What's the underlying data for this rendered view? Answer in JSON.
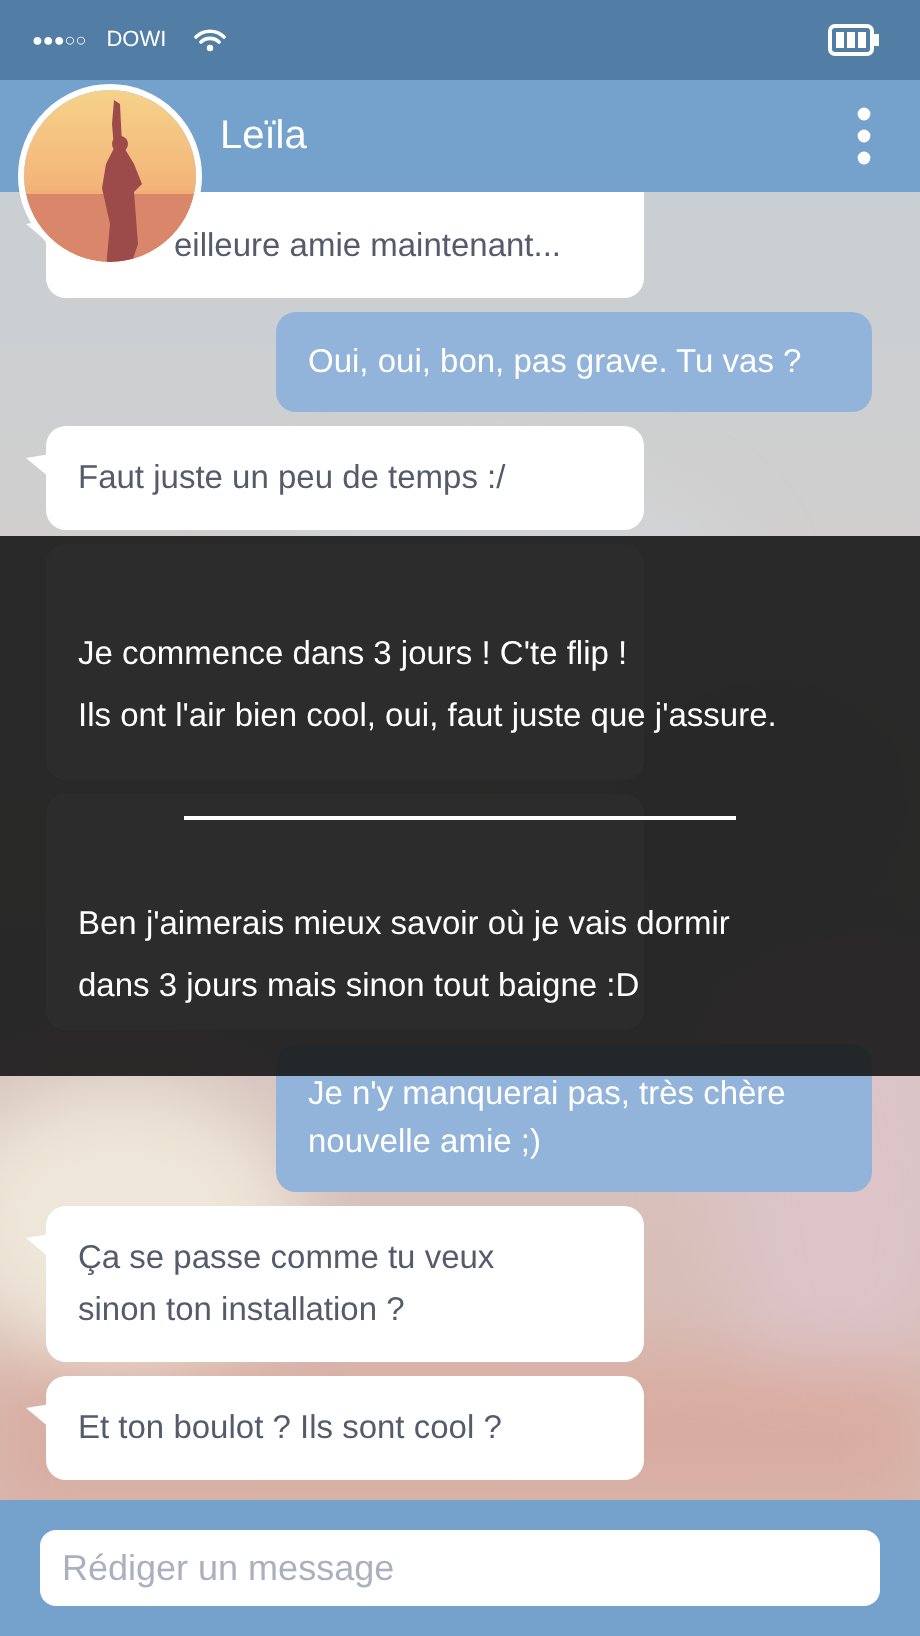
{
  "status_bar": {
    "signal": "●●●○○",
    "carrier": "DOWI"
  },
  "header": {
    "contact_name": "Leïla"
  },
  "messages": [
    {
      "kind": "received",
      "lines": [
        "eilleure amie maintenant..."
      ]
    },
    {
      "kind": "sent",
      "lines": [
        "Oui, oui, bon, pas grave. Tu vas ?"
      ]
    },
    {
      "kind": "received",
      "lines": [
        "Faut juste un peu de temps :/"
      ]
    },
    {
      "kind": "received"
    },
    {
      "kind": "received"
    },
    {
      "kind": "sent",
      "lines": [
        "Je n'y manquerai pas, très chère",
        "nouvelle amie ;)"
      ]
    },
    {
      "kind": "received",
      "lines": [
        "Ça se passe comme tu veux",
        "sinon ton installation ?"
      ]
    },
    {
      "kind": "received",
      "lines": [
        "Et ton boulot ? Ils sont cool ?"
      ]
    }
  ],
  "choices": [
    {
      "text": "Je commence dans 3 jours ! C'te flip !"
    },
    {
      "text": "Ils ont l'air bien cool, oui, faut juste que j'assure."
    },
    {
      "text": "Ben j'aimerais mieux savoir où je vais dormir dans 3 jours mais sinon tout baigne :D"
    }
  ],
  "composer": {
    "placeholder": "Rédiger un message"
  }
}
